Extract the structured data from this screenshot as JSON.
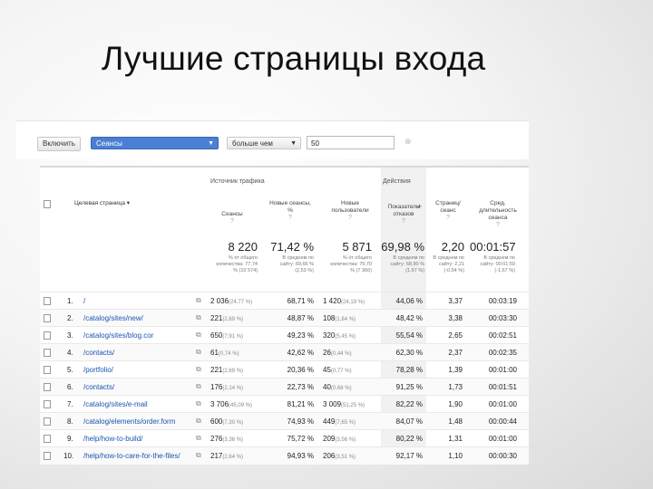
{
  "slide": {
    "title": "Лучшие страницы входа"
  },
  "toolbar": {
    "include_label": "Включить",
    "select_value": "Сеансы",
    "operator_value": "больше чем",
    "input_value": "50",
    "accent": "#4a7fd4"
  },
  "table": {
    "group_traffic": "Источник трафика",
    "group_behavior": "Действия",
    "col_page": "Целевая страница",
    "col_sessions": "Сеансы",
    "col_new_sessions": "Новые сеансы, %",
    "col_new_users": "Новые пользователи",
    "col_bounce": "Показатель отказов",
    "col_pages_per_session": "Страниц/сеанс",
    "col_avg_duration": "Сред. длительность сеанса",
    "totals": {
      "sessions": "8 220",
      "new_sessions": "71,42 %",
      "new_users": "5 871",
      "bounce": "69,98 %",
      "pages_per_session": "2,20",
      "avg_duration": "00:01:57",
      "sessions_note": "% от общего количества: 77,74 % (10 574)",
      "new_sessions_note": "В среднем по сайту: 69,66 % (2,53 %)",
      "new_users_note": "% от общего количества: 79,70 % (7 366)",
      "bounce_note": "В среднем по сайту: 68,90 % (1,57 %)",
      "pages_note": "В среднем по сайту: 2,21 (-0,54 %)",
      "duration_note": "В среднем по сайту: 00:01:59 (-1,67 %)"
    },
    "rows": [
      {
        "num": "1.",
        "page": "/",
        "sessions": "2 036",
        "sessions_pct": "(24,77 %)",
        "new_sessions": "68,71 %",
        "new_users": "1 420",
        "new_users_pct": "(24,19 %)",
        "bounce": "44,06 %",
        "pps": "3,37",
        "dur": "00:03:19"
      },
      {
        "num": "2.",
        "page": "/catalog/sites/new/",
        "sessions": "221",
        "sessions_pct": "(2,69 %)",
        "new_sessions": "48,87 %",
        "new_users": "108",
        "new_users_pct": "(1,84 %)",
        "bounce": "48,42 %",
        "pps": "3,38",
        "dur": "00:03:30"
      },
      {
        "num": "3.",
        "page": "/catalog/sites/blog.cor",
        "sessions": "650",
        "sessions_pct": "(7,91 %)",
        "new_sessions": "49,23 %",
        "new_users": "320",
        "new_users_pct": "(5,45 %)",
        "bounce": "55,54 %",
        "pps": "2,65",
        "dur": "00:02:51"
      },
      {
        "num": "4.",
        "page": "/contacts/",
        "sessions": "61",
        "sessions_pct": "(0,74 %)",
        "new_sessions": "42,62 %",
        "new_users": "26",
        "new_users_pct": "(0,44 %)",
        "bounce": "62,30 %",
        "pps": "2,37",
        "dur": "00:02:35"
      },
      {
        "num": "5.",
        "page": "/portfolio/",
        "sessions": "221",
        "sessions_pct": "(2,69 %)",
        "new_sessions": "20,36 %",
        "new_users": "45",
        "new_users_pct": "(0,77 %)",
        "bounce": "78,28 %",
        "pps": "1,39",
        "dur": "00:01:00"
      },
      {
        "num": "6.",
        "page": "/contacts/",
        "sessions": "176",
        "sessions_pct": "(2,14 %)",
        "new_sessions": "22,73 %",
        "new_users": "40",
        "new_users_pct": "(0,68 %)",
        "bounce": "91,25 %",
        "pps": "1,73",
        "dur": "00:01:51"
      },
      {
        "num": "7.",
        "page": "/catalog/sites/e-mail",
        "sessions": "3 706",
        "sessions_pct": "(45,09 %)",
        "new_sessions": "81,21 %",
        "new_users": "3 009",
        "new_users_pct": "(51,25 %)",
        "bounce": "82,22 %",
        "pps": "1,90",
        "dur": "00:01:00"
      },
      {
        "num": "8.",
        "page": "/catalog/elements/order.form",
        "sessions": "600",
        "sessions_pct": "(7,30 %)",
        "new_sessions": "74,93 %",
        "new_users": "449",
        "new_users_pct": "(7,65 %)",
        "bounce": "84,07 %",
        "pps": "1,48",
        "dur": "00:00:44"
      },
      {
        "num": "9.",
        "page": "/help/how-to-build/",
        "sessions": "276",
        "sessions_pct": "(3,36 %)",
        "new_sessions": "75,72 %",
        "new_users": "209",
        "new_users_pct": "(3,56 %)",
        "bounce": "80,22 %",
        "pps": "1,31",
        "dur": "00:01:00"
      },
      {
        "num": "10.",
        "page": "/help/how-to-care-for-the-files/",
        "sessions": "217",
        "sessions_pct": "(2,64 %)",
        "new_sessions": "94,93 %",
        "new_users": "206",
        "new_users_pct": "(3,51 %)",
        "bounce": "92,17 %",
        "pps": "1,10",
        "dur": "00:00:30"
      }
    ]
  }
}
